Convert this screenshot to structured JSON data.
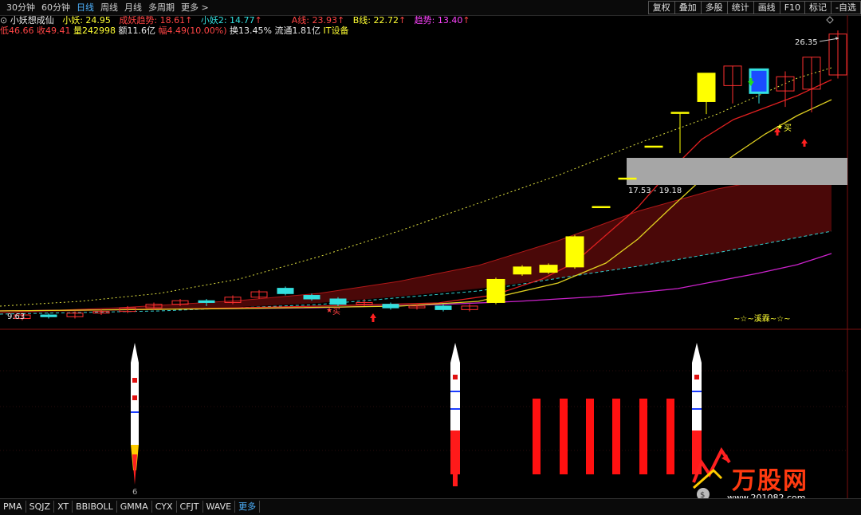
{
  "periods": [
    "30分钟",
    "60分钟",
    "日线",
    "周线",
    "月线",
    "多周期",
    "更多 >"
  ],
  "active_period": "日线",
  "right_tools": [
    "复权",
    "叠加",
    "多股",
    "统计",
    "画线",
    "F10",
    "标记",
    "-自选"
  ],
  "indicator_line": {
    "name": "小妖想成仙",
    "items": [
      {
        "text": "小妖: 24.95",
        "color": "#ffff33"
      },
      {
        "text": "成妖趋势: 18.61",
        "color": "#ff4545"
      },
      {
        "text": "小妖2: 14.77",
        "color": "#33e0e0"
      },
      {
        "text": "A线: 23.93",
        "color": "#ff4545"
      },
      {
        "text": "B线: 22.72",
        "color": "#ffff33"
      },
      {
        "text": "趋势: 13.40",
        "color": "#ff44ff"
      }
    ]
  },
  "quote_line": {
    "items": [
      {
        "text": "低46.66",
        "color": "#ff4545"
      },
      {
        "text": "收49.41",
        "color": "#ff4545"
      },
      {
        "text": "量242998",
        "color": "#ffff33"
      },
      {
        "text": "额11.6亿",
        "color": "#e8e8e8"
      },
      {
        "text": "幅4.49(10.00%)",
        "color": "#ff4545"
      },
      {
        "text": "换13.45%",
        "color": "#e8e8e8"
      },
      {
        "text": "流通1.81亿",
        "color": "#e8e8e8"
      },
      {
        "text": "IT设备",
        "color": "#ffff33"
      }
    ]
  },
  "chart_labels": {
    "high_price": "26.35",
    "zone_range": "17.53 - 19.18",
    "buy_label": "买",
    "buy_label_left": "买",
    "low_price": "9.63",
    "watermark_text": "~☆~溪霖~☆~",
    "sub_axis_label": "6"
  },
  "indicator_tabs": [
    "PMA",
    "SQJZ",
    "XT",
    "BBIBOLL",
    "GMMA",
    "CYX",
    "CFJT",
    "WAVE",
    "更多"
  ],
  "logo": {
    "text": "万股网",
    "url_text": "www.201082.com"
  },
  "colors": {
    "up": "#ff3030",
    "yellow": "#ffff00",
    "blue": "#1a4cff",
    "cyan": "#33e0e0",
    "magenta": "#cc22cc"
  },
  "chart_data": {
    "type": "candlestick",
    "candles": [
      {
        "o": 10.1,
        "c": 10.3,
        "h": 10.4,
        "l": 10.0
      },
      {
        "o": 10.3,
        "c": 10.2,
        "h": 10.4,
        "l": 10.1
      },
      {
        "o": 10.2,
        "c": 10.4,
        "h": 10.5,
        "l": 10.1
      },
      {
        "o": 10.4,
        "c": 10.5,
        "h": 10.6,
        "l": 10.3
      },
      {
        "o": 10.5,
        "c": 10.7,
        "h": 10.8,
        "l": 10.4
      },
      {
        "o": 10.7,
        "c": 10.9,
        "h": 11.0,
        "l": 10.6
      },
      {
        "o": 10.9,
        "c": 11.1,
        "h": 11.2,
        "l": 10.8
      },
      {
        "o": 11.1,
        "c": 11.0,
        "h": 11.2,
        "l": 10.8
      },
      {
        "o": 11.0,
        "c": 11.3,
        "h": 11.4,
        "l": 10.9
      },
      {
        "o": 11.3,
        "c": 11.6,
        "h": 11.7,
        "l": 11.2
      },
      {
        "o": 11.8,
        "c": 11.5,
        "h": 11.9,
        "l": 11.4
      },
      {
        "o": 11.4,
        "c": 11.2,
        "h": 11.5,
        "l": 11.1
      },
      {
        "o": 11.2,
        "c": 10.9,
        "h": 11.3,
        "l": 10.8
      },
      {
        "o": 10.9,
        "c": 11.0,
        "h": 11.2,
        "l": 10.8
      },
      {
        "o": 10.9,
        "c": 10.7,
        "h": 11.0,
        "l": 10.6
      },
      {
        "o": 10.7,
        "c": 10.8,
        "h": 10.9,
        "l": 10.6
      },
      {
        "o": 10.8,
        "c": 10.6,
        "h": 10.9,
        "l": 10.5
      },
      {
        "o": 10.6,
        "c": 10.8,
        "h": 10.9,
        "l": 10.5
      },
      {
        "o": 11.0,
        "c": 12.3,
        "h": 12.4,
        "l": 10.9
      },
      {
        "o": 12.6,
        "c": 13.0,
        "h": 13.1,
        "l": 12.5
      },
      {
        "o": 12.7,
        "c": 13.1,
        "h": 13.2,
        "l": 12.6
      },
      {
        "o": 13.0,
        "c": 14.7,
        "h": 14.8,
        "l": 12.9
      },
      {
        "o": 16.4,
        "c": 16.4,
        "h": 16.4,
        "l": 16.4
      },
      {
        "o": 18.0,
        "c": 18.0,
        "h": 18.0,
        "l": 18.0
      },
      {
        "o": 19.8,
        "c": 19.8,
        "h": 19.8,
        "l": 19.8
      },
      {
        "o": 21.7,
        "c": 21.7,
        "h": 21.7,
        "l": 19.4
      },
      {
        "o": 22.3,
        "c": 23.9,
        "h": 23.9,
        "l": 21.6
      },
      {
        "o": 23.2,
        "c": 24.3,
        "h": 24.3,
        "l": 22.2
      },
      {
        "o": 24.1,
        "c": 22.8,
        "h": 24.1,
        "l": 22.2
      },
      {
        "o": 22.9,
        "c": 23.7,
        "h": 24.0,
        "l": 22.0
      },
      {
        "o": 23.0,
        "c": 24.8,
        "h": 24.8,
        "l": 21.7
      },
      {
        "o": 23.8,
        "c": 26.1,
        "h": 26.3,
        "l": 23.6
      }
    ]
  }
}
